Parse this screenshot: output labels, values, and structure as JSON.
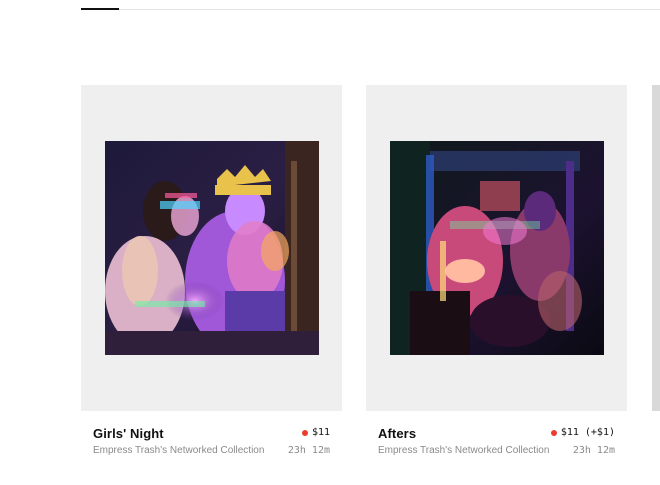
{
  "colors": {
    "live_dot": "#ec3b2f",
    "card_background": "#efefef",
    "muted_text": "#8a8a8a"
  },
  "cards": [
    {
      "title": "Girls' Night",
      "price": "$11",
      "collection": "Empress Trash's Networked Collection",
      "time_left": "23h  12m",
      "status_icon": "live-dot-icon"
    },
    {
      "title": "Afters",
      "price": "$11 (+$1)",
      "collection": "Empress Trash's Networked Collection",
      "time_left": "23h  12m",
      "status_icon": "live-dot-icon"
    }
  ]
}
